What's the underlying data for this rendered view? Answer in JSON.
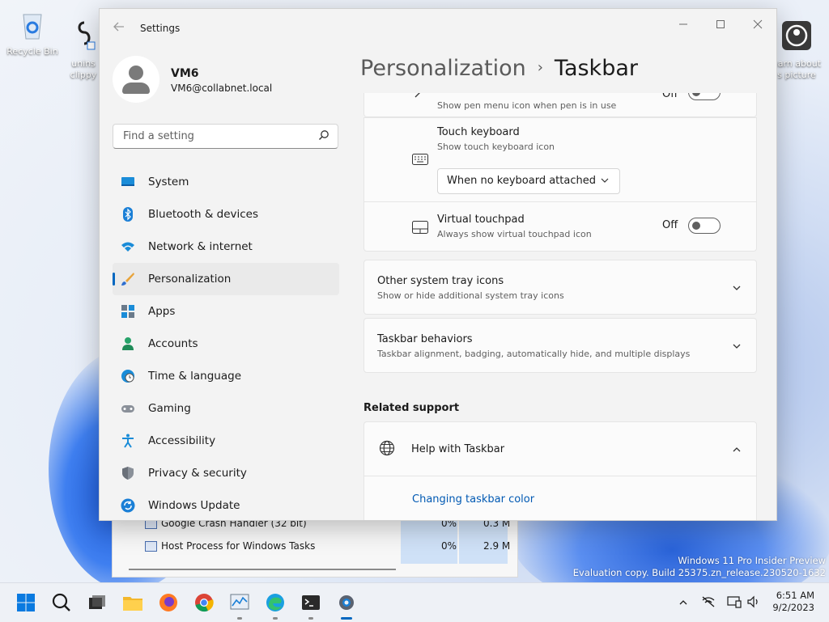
{
  "desktop": {
    "icons": [
      {
        "label": "Recycle Bin"
      },
      {
        "label": "unins\nclippy"
      },
      {
        "label": "earn about\ns picture"
      }
    ],
    "watermark": {
      "line1": "Windows 11 Pro Insider Preview",
      "line2": "Evaluation copy. Build 25375.zn_release.230520-1632"
    }
  },
  "taskmgr": {
    "rows": [
      {
        "name": "Google Crash Handler (32 bit)",
        "cpu": "0%",
        "mem": "0.3 M"
      },
      {
        "name": "Host Process for Windows Tasks",
        "cpu": "0%",
        "mem": "2.9 M"
      }
    ]
  },
  "window": {
    "title": "Settings",
    "user": {
      "name": "VM6",
      "email": "VM6@collabnet.local"
    },
    "search": {
      "placeholder": "Find a setting"
    },
    "nav": [
      {
        "label": "System",
        "icon": "system-icon"
      },
      {
        "label": "Bluetooth & devices",
        "icon": "bluetooth-icon"
      },
      {
        "label": "Network & internet",
        "icon": "wifi-icon"
      },
      {
        "label": "Personalization",
        "icon": "brush-icon",
        "active": true
      },
      {
        "label": "Apps",
        "icon": "apps-icon"
      },
      {
        "label": "Accounts",
        "icon": "accounts-icon"
      },
      {
        "label": "Time & language",
        "icon": "clock-globe-icon"
      },
      {
        "label": "Gaming",
        "icon": "gamepad-icon"
      },
      {
        "label": "Accessibility",
        "icon": "accessibility-icon"
      },
      {
        "label": "Privacy & security",
        "icon": "shield-icon"
      },
      {
        "label": "Windows Update",
        "icon": "update-icon"
      }
    ],
    "breadcrumb": {
      "parent": "Personalization",
      "current": "Taskbar"
    },
    "settings": {
      "pen_menu": {
        "subtitle": "Show pen menu icon when pen is in use",
        "state": "Off"
      },
      "touch_keyboard": {
        "title": "Touch keyboard",
        "subtitle": "Show touch keyboard icon",
        "dropdown": "When no keyboard attached"
      },
      "virtual_touchpad": {
        "title": "Virtual touchpad",
        "subtitle": "Always show virtual touchpad icon",
        "state": "Off"
      },
      "other_tray": {
        "title": "Other system tray icons",
        "subtitle": "Show or hide additional system tray icons"
      },
      "behaviors": {
        "title": "Taskbar behaviors",
        "subtitle": "Taskbar alignment, badging, automatically hide, and multiple displays"
      }
    },
    "related": {
      "heading": "Related support",
      "help_title": "Help with Taskbar",
      "link": "Changing taskbar color"
    }
  },
  "taskbar": {
    "time": "6:51 AM",
    "date": "9/2/2023"
  },
  "colors": {
    "accent": "#0067c0",
    "link": "#0059b3"
  }
}
